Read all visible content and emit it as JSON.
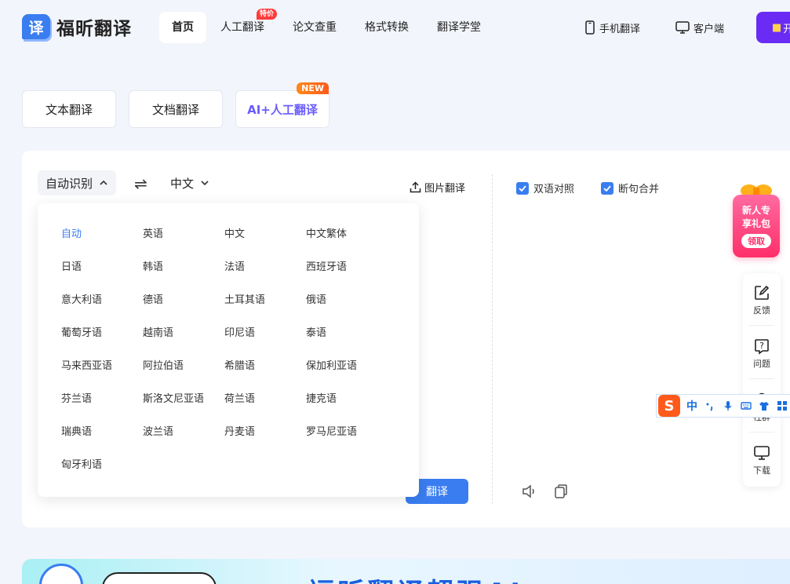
{
  "logo": {
    "mark": "译",
    "name": "福昕翻译"
  },
  "nav": {
    "items": [
      {
        "label": "首页"
      },
      {
        "label": "人工翻译",
        "badge": "特价"
      },
      {
        "label": "论文查重"
      },
      {
        "label": "格式转换"
      },
      {
        "label": "翻译学堂"
      }
    ],
    "mobile": "手机翻译",
    "desktop": "客户端",
    "vip": "开"
  },
  "modes": {
    "text": "文本翻译",
    "doc": "文档翻译",
    "ai": "AI+人工翻译",
    "new_badge": "NEW"
  },
  "translator": {
    "source_lang": "自动识别",
    "target_lang": "中文",
    "image_translate": "图片翻译",
    "bilingual": "双语对照",
    "merge_sentences": "断句合并",
    "translate_button": "翻译"
  },
  "languages": [
    "自动",
    "英语",
    "中文",
    "中文繁体",
    "日语",
    "韩语",
    "法语",
    "西班牙语",
    "意大利语",
    "德语",
    "土耳其语",
    "俄语",
    "葡萄牙语",
    "越南语",
    "印尼语",
    "泰语",
    "马来西亚语",
    "阿拉伯语",
    "希腊语",
    "保加利亚语",
    "芬兰语",
    "斯洛文尼亚语",
    "荷兰语",
    "捷克语",
    "瑞典语",
    "波兰语",
    "丹麦语",
    "罗马尼亚语",
    "匈牙利语"
  ],
  "selected_language": "自动",
  "gift": {
    "line1": "新人专",
    "line2": "享礼包",
    "claim": "领取"
  },
  "side_toolbar": {
    "feedback": "反馈",
    "question": "问题",
    "group": "社群",
    "download": "下载"
  },
  "ime": {
    "logo": "S",
    "mode": "中"
  },
  "banner": {
    "title": "福昕翻译超强AI"
  },
  "colors": {
    "accent": "#3a7df0",
    "vip": "#6a2cf5",
    "badge": "#ff3b3b"
  }
}
